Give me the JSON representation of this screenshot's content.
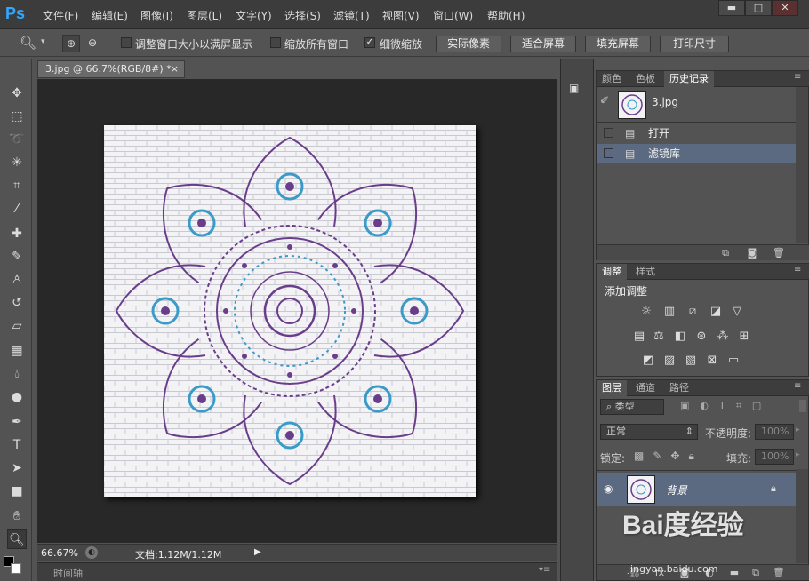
{
  "app": {
    "logo": "Ps"
  },
  "menu": [
    "文件(F)",
    "编辑(E)",
    "图像(I)",
    "图层(L)",
    "文字(Y)",
    "选择(S)",
    "滤镜(T)",
    "视图(V)",
    "窗口(W)",
    "帮助(H)"
  ],
  "window_controls": {
    "minimize": "▬",
    "restore": "□",
    "close": "✕"
  },
  "options": {
    "resize_window": "调整窗口大小以满屏显示",
    "zoom_all": "缩放所有窗口",
    "scrubby_zoom": "细微缩放",
    "scrubby_checked": true,
    "actual_pixels": "实际像素",
    "fit_screen": "适合屏幕",
    "fill_screen": "填充屏幕",
    "print_size": "打印尺寸"
  },
  "document": {
    "tab_title": "3.jpg @ 66.7%(RGB/8#) *",
    "tab_close": "×"
  },
  "status": {
    "zoom": "66.67%",
    "doc_info": "文档:1.12M/1.12M"
  },
  "timeline": {
    "label": "时间轴"
  },
  "panels": {
    "top_tabs": [
      "颜色",
      "色板",
      "历史记录"
    ],
    "history": {
      "snapshot": "3.jpg",
      "items": [
        "打开",
        "滤镜库"
      ]
    },
    "adjust_tabs": [
      "调整",
      "样式"
    ],
    "adjust_title": "添加调整",
    "layers_tabs": [
      "图层",
      "通道",
      "路径"
    ],
    "layer_filter": "类型",
    "blend_mode": "正常",
    "opacity_label": "不透明度:",
    "opacity_value": "100%",
    "lock_label": "锁定:",
    "fill_label": "填充:",
    "fill_value": "100%",
    "layer_name": "背景"
  },
  "watermark": {
    "text": "Bai度经验",
    "sub": "jingyan.baidu.com"
  }
}
